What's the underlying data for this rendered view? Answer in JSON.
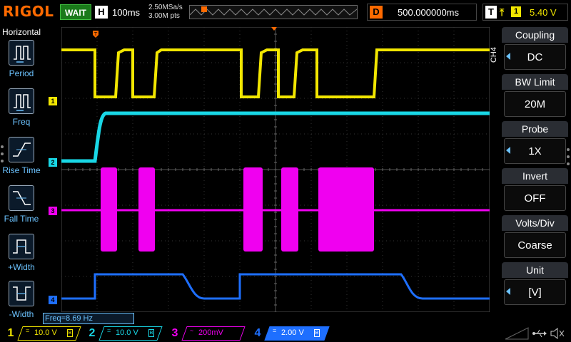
{
  "brand": "RIGOL",
  "run_status": "WAIT",
  "horizontal": {
    "label": "H",
    "timebase": "100ms",
    "sample_rate": "2.50MSa/s",
    "mem_depth": "3.00M pts"
  },
  "delay": {
    "label": "D",
    "value": "500.000000ms"
  },
  "trigger": {
    "label": "T",
    "edge_icon": "rising-edge-icon",
    "source": "1",
    "level": "5.40 V"
  },
  "left_menu": {
    "title": "Horizontal",
    "items": [
      {
        "label": "Period",
        "icon": "period-icon"
      },
      {
        "label": "Freq",
        "icon": "freq-icon"
      },
      {
        "label": "Rise Time",
        "icon": "rise-time-icon"
      },
      {
        "label": "Fall Time",
        "icon": "fall-time-icon"
      },
      {
        "label": "+Width",
        "icon": "positive-width-icon"
      },
      {
        "label": "-Width",
        "icon": "negative-width-icon"
      }
    ]
  },
  "right_menu": {
    "channel_tag": "CH4",
    "items": [
      {
        "title": "Coupling",
        "value": "DC",
        "has_arrow": true
      },
      {
        "title": "BW Limit",
        "value": "20M",
        "has_arrow": false
      },
      {
        "title": "Probe",
        "value": "1X",
        "has_arrow": true
      },
      {
        "title": "Invert",
        "value": "OFF",
        "has_arrow": false
      },
      {
        "title": "Volts/Div",
        "value": "Coarse",
        "has_arrow": false
      },
      {
        "title": "Unit",
        "value": "[V]",
        "has_arrow": true
      }
    ]
  },
  "measurement": "Freq=8.69 Hz",
  "channels": [
    {
      "num": "1",
      "color": "#f2e600",
      "coupling": "=",
      "scale": "10.0 V",
      "bw": "B",
      "marker": "1"
    },
    {
      "num": "2",
      "color": "#19d7e6",
      "coupling": "=",
      "scale": "10.0 V",
      "bw": "B",
      "marker": "2"
    },
    {
      "num": "3",
      "color": "#f000f0",
      "coupling": "~",
      "scale": "200mV",
      "bw": "",
      "marker": "3"
    },
    {
      "num": "4",
      "color": "#1e6fff",
      "coupling": "=",
      "scale": "2.00 V",
      "bw": "B",
      "marker": "4"
    }
  ],
  "status_icons": [
    "usb-icon",
    "speaker-muted-icon"
  ],
  "colors": {
    "ch1": "#f2e600",
    "ch2": "#19d7e6",
    "ch3": "#f000f0",
    "ch4": "#1e6fff",
    "trigger": "#ff6a00",
    "menu_accent": "#6cc3ff"
  }
}
